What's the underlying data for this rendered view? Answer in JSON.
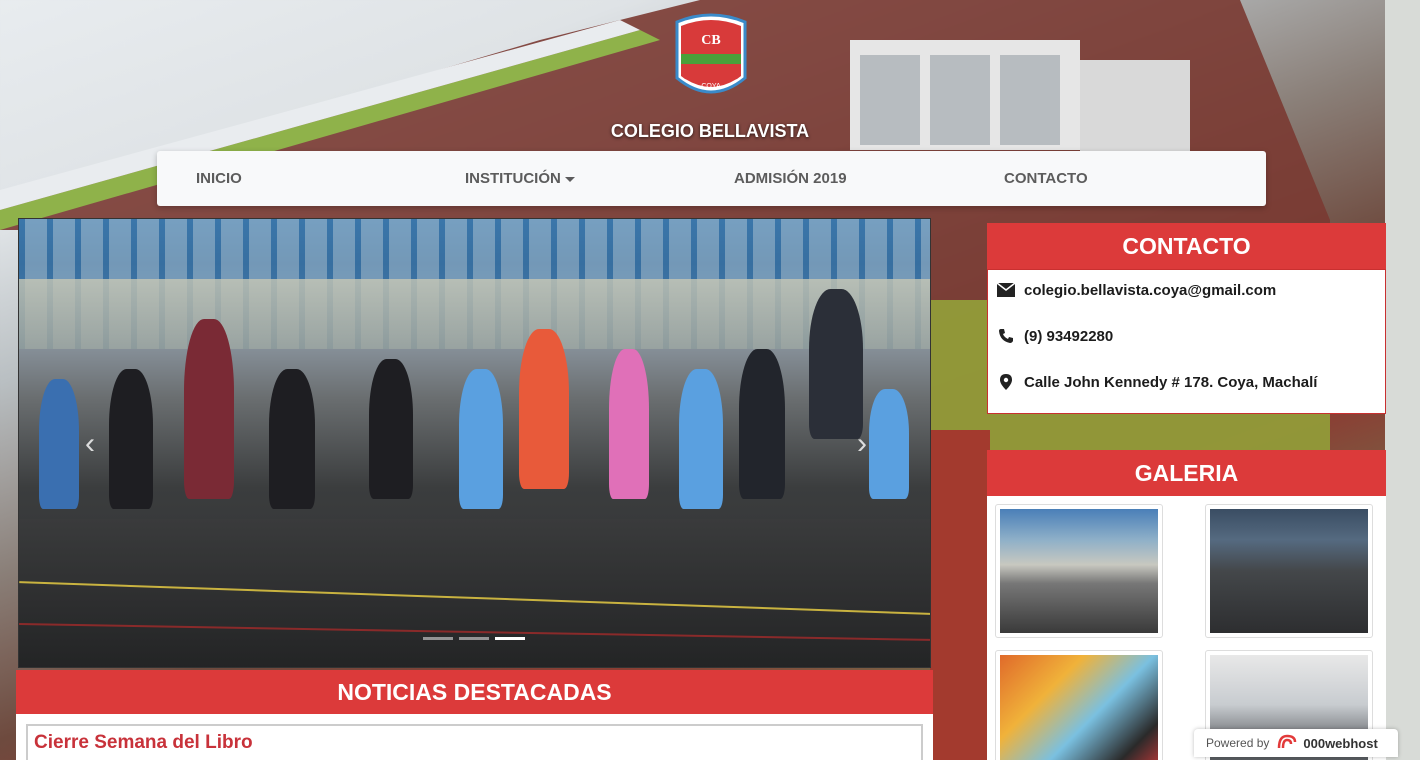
{
  "header": {
    "logo_top_text": "COLEGIO BELLAVISTA",
    "logo_bottom_text": "COYA",
    "school_name": "COLEGIO BELLAVISTA"
  },
  "nav": {
    "items": [
      {
        "label": "INICIO"
      },
      {
        "label": "INSTITUCIÓN",
        "dropdown": true
      },
      {
        "label": "ADMISIÓN 2019"
      },
      {
        "label": "CONTACTO"
      }
    ]
  },
  "carousel": {
    "prev_symbol": "‹",
    "next_symbol": "›",
    "slide_count": 3,
    "active_index": 2
  },
  "noticias": {
    "title": "NOTICIAS DESTACADAS",
    "items": [
      {
        "title": "Cierre Semana del Libro"
      }
    ]
  },
  "contacto": {
    "title": "CONTACTO",
    "email": "colegio.bellavista.coya@gmail.com",
    "phone": "(9) 93492280",
    "address": "Calle John Kennedy # 178. Coya, Machalí"
  },
  "galeria": {
    "title": "GALERIA"
  },
  "footer_badge": {
    "prefix": "Powered by",
    "brand": "000webhost"
  },
  "colors": {
    "accent_red": "#dc3a3a",
    "nav_bg": "#f8f9fa",
    "news_title": "#c8323a"
  }
}
